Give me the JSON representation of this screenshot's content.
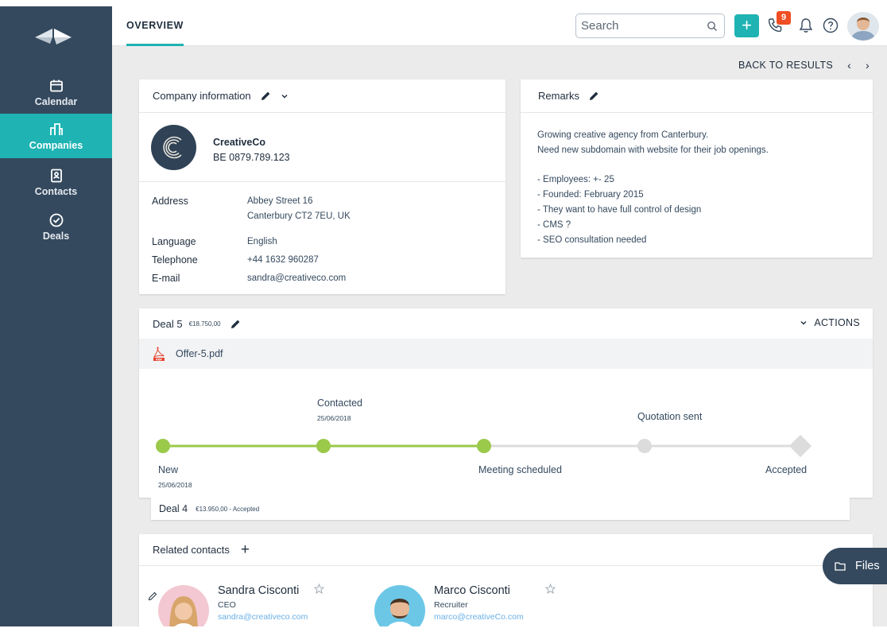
{
  "sidebar": {
    "items": [
      {
        "label": "Calendar",
        "icon": "calendar-icon"
      },
      {
        "label": "Companies",
        "icon": "companies-icon",
        "active": true
      },
      {
        "label": "Contacts",
        "icon": "contacts-icon"
      },
      {
        "label": "Deals",
        "icon": "deals-icon"
      }
    ]
  },
  "header": {
    "tab_label": "OVERVIEW",
    "search_placeholder": "Search",
    "add_label": "+",
    "notification_count": "9"
  },
  "nav": {
    "back_label": "BACK TO RESULTS"
  },
  "company": {
    "title": "Company information",
    "name": "CreativeCo",
    "vat": "BE 0879.789.123",
    "fields": {
      "address_label": "Address",
      "address_line1": "Abbey Street 16",
      "address_line2": "Canterbury CT2 7EU, UK",
      "language_label": "Language",
      "language_value": "English",
      "telephone_label": "Telephone",
      "telephone_value": "+44 1632 960287",
      "email_label": "E-mail",
      "email_value": "sandra@creativeco.com"
    }
  },
  "remarks": {
    "title": "Remarks",
    "lines": [
      "Growing creative agency from Canterbury.",
      "Need new subdomain with website for their job openings.",
      "",
      "- Employees: +- 25",
      "- Founded: February 2015",
      "- They want to have full control of design",
      "- CMS ?",
      "- SEO consultation needed"
    ]
  },
  "deal": {
    "title": "Deal 5",
    "amount": "€18.750,00",
    "actions_label": "ACTIONS",
    "file_name": "Offer-5.pdf",
    "stages": [
      {
        "label": "New",
        "date": "25/06/2018",
        "done": true
      },
      {
        "label": "Contacted",
        "date": "25/06/2018",
        "done": true
      },
      {
        "label": "Meeting scheduled",
        "date": "",
        "done": true
      },
      {
        "label": "Quotation sent",
        "date": "",
        "done": false
      },
      {
        "label": "Accepted",
        "date": "",
        "done": false
      }
    ],
    "colors": {
      "done": "#9bc94a",
      "pending": "#dcdcdc"
    }
  },
  "deal_other": {
    "title": "Deal 4",
    "meta": "€13.950,00 - Accepted"
  },
  "related": {
    "title": "Related contacts",
    "contacts": [
      {
        "name": "Sandra Cisconti",
        "role": "CEO",
        "email": "sandra@creativeco.com"
      },
      {
        "name": "Marco Cisconti",
        "role": "Recruiter",
        "email": "marco@creativeCo.com"
      }
    ]
  },
  "files": {
    "label": "Files"
  }
}
